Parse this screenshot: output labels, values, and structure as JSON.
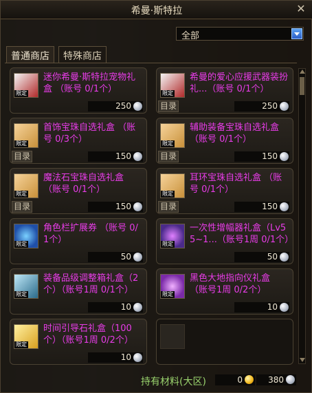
{
  "window": {
    "title": "希曼·斯特拉",
    "close_label": "✕"
  },
  "filter": {
    "selected": "全部"
  },
  "tabs": [
    {
      "label": "普通商店",
      "active": true
    },
    {
      "label": "特殊商店",
      "active": false
    }
  ],
  "badge_text": "限定",
  "catalog_label": "目录",
  "items": [
    {
      "name": "迷你希曼·斯特拉宠物礼盒 （账号 0/1个）",
      "price": "250",
      "has_catalog": false,
      "limited": true,
      "icon": "gift-box-icon",
      "icon_color": "#b02a2a"
    },
    {
      "name": "希曼的爱心应援武器装扮礼...（账号 0/1个）",
      "price": "250",
      "has_catalog": true,
      "limited": true,
      "icon": "gift-box-icon",
      "icon_color": "#b02a2a"
    },
    {
      "name": "首饰宝珠自选礼盒 （账号 0/3个）",
      "price": "150",
      "has_catalog": true,
      "limited": true,
      "icon": "orb-box-icon",
      "icon_color": "#c8903a"
    },
    {
      "name": "辅助装备宝珠自选礼盒 （账号 0/1个）",
      "price": "150",
      "has_catalog": true,
      "limited": true,
      "icon": "orb-box-icon",
      "icon_color": "#c8903a"
    },
    {
      "name": "魔法石宝珠自选礼盒 （账号 0/1个）",
      "price": "150",
      "has_catalog": true,
      "limited": true,
      "icon": "orb-box-icon",
      "icon_color": "#c8903a"
    },
    {
      "name": "耳环宝珠自选礼盒 （账号 0/1个）",
      "price": "150",
      "has_catalog": true,
      "limited": true,
      "icon": "orb-box-icon",
      "icon_color": "#c8903a"
    },
    {
      "name": "角色栏扩展券 （账号 0/1个）",
      "price": "50",
      "has_catalog": false,
      "limited": true,
      "icon": "character-slot-icon",
      "icon_color": "#1f4fa8"
    },
    {
      "name": "一次性增幅器礼盒（Lv55~1...（账号1周 0/1个）",
      "price": "50",
      "has_catalog": false,
      "limited": true,
      "icon": "amplifier-icon",
      "icon_color": "#4a2a8a"
    },
    {
      "name": "装备品级调整箱礼盒（2个）（账号1周 0/1个）",
      "price": "10",
      "has_catalog": false,
      "limited": true,
      "icon": "equipment-box-icon",
      "icon_color": "#2a6a8a"
    },
    {
      "name": "黑色大地指向仪礼盒 （账号1周 0/2个）",
      "price": "10",
      "has_catalog": false,
      "limited": true,
      "icon": "compass-icon",
      "icon_color": "#7a2aa8"
    },
    {
      "name": "时间引导石礼盒（100个）（账号1周 0/2个）",
      "price": "10",
      "has_catalog": false,
      "limited": true,
      "icon": "stone-box-icon",
      "icon_color": "#d8a020"
    }
  ],
  "footer": {
    "label": "持有材料(大区)",
    "gold": "0",
    "silver": "380"
  },
  "colors": {
    "item_name": "#e83ce8",
    "footer_label": "#9ad46e"
  }
}
